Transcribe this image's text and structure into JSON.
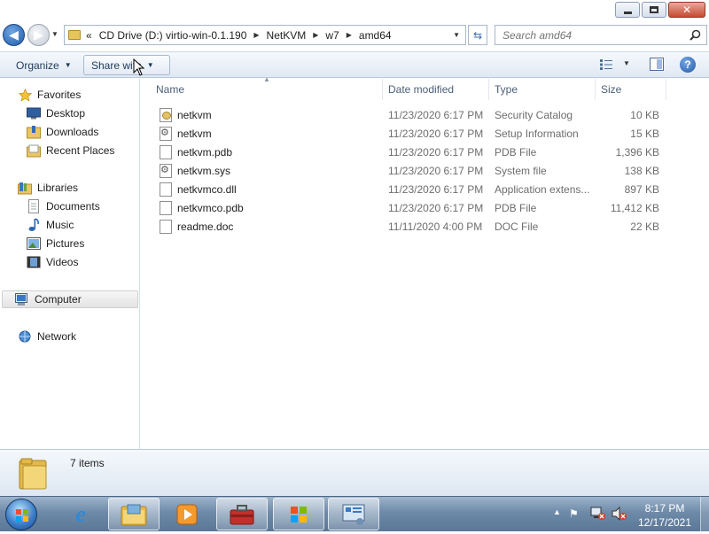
{
  "address": {
    "overflow": "«",
    "crumbs": [
      "CD Drive (D:) virtio-win-0.1.190",
      "NetKVM",
      "w7",
      "amd64"
    ]
  },
  "search": {
    "placeholder": "Search amd64"
  },
  "toolbar": {
    "organize_label": "Organize",
    "share_label": "Share with"
  },
  "sidebar": {
    "favorites": "Favorites",
    "desktop": "Desktop",
    "downloads": "Downloads",
    "recent": "Recent Places",
    "libraries": "Libraries",
    "documents": "Documents",
    "music": "Music",
    "pictures": "Pictures",
    "videos": "Videos",
    "computer": "Computer",
    "network": "Network"
  },
  "columns": {
    "name": "Name",
    "date": "Date modified",
    "type": "Type",
    "size": "Size"
  },
  "files": [
    {
      "name": "netkvm",
      "date": "11/23/2020 6:17 PM",
      "type": "Security Catalog",
      "size": "10 KB",
      "icon": "catalog-file-icon"
    },
    {
      "name": "netkvm",
      "date": "11/23/2020 6:17 PM",
      "type": "Setup Information",
      "size": "15 KB",
      "icon": "setup-info-file-icon"
    },
    {
      "name": "netkvm.pdb",
      "date": "11/23/2020 6:17 PM",
      "type": "PDB File",
      "size": "1,396 KB",
      "icon": "file-icon"
    },
    {
      "name": "netkvm.sys",
      "date": "11/23/2020 6:17 PM",
      "type": "System file",
      "size": "138 KB",
      "icon": "system-file-icon"
    },
    {
      "name": "netkvmco.dll",
      "date": "11/23/2020 6:17 PM",
      "type": "Application extens...",
      "size": "897 KB",
      "icon": "file-icon"
    },
    {
      "name": "netkvmco.pdb",
      "date": "11/23/2020 6:17 PM",
      "type": "PDB File",
      "size": "11,412 KB",
      "icon": "file-icon"
    },
    {
      "name": "readme.doc",
      "date": "11/11/2020 4:00 PM",
      "type": "DOC File",
      "size": "22 KB",
      "icon": "file-icon"
    }
  ],
  "details": {
    "count": "7 items"
  },
  "clock": {
    "time": "8:17 PM",
    "date": "12/17/2021"
  }
}
